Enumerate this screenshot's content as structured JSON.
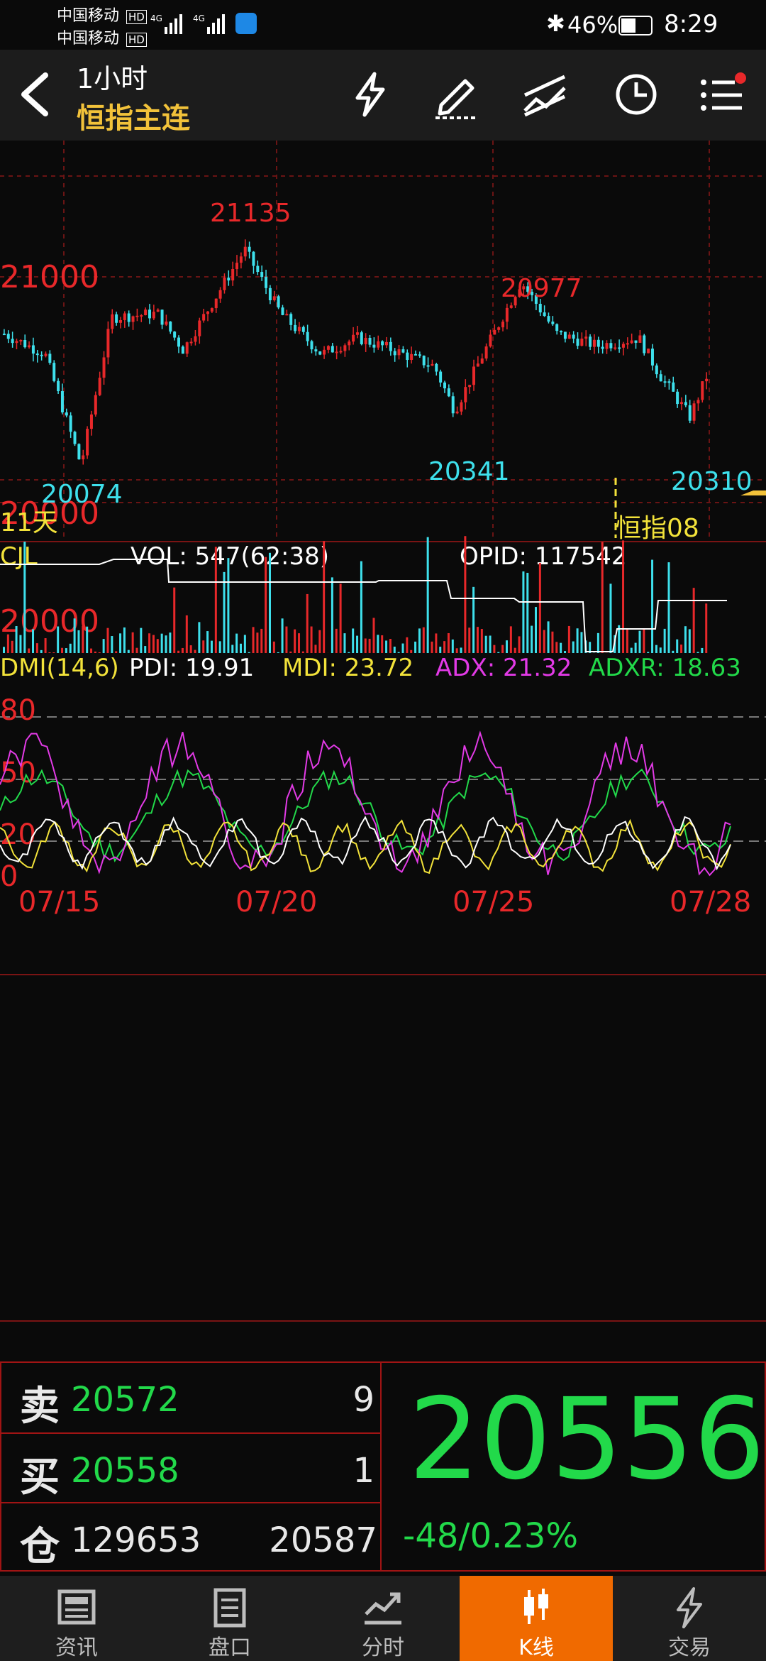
{
  "status_bar": {
    "carrier1": "中国移动",
    "carrier2": "中国移动",
    "hd": "HD",
    "network": "4G",
    "battery": "46%",
    "time": "8:29"
  },
  "header": {
    "period": "1小时",
    "instrument": "恒指主连"
  },
  "main_chart": {
    "y_labels": [
      "21000",
      "20000"
    ],
    "high_label": "21135",
    "low_label": "20074",
    "mark_20977": "20977",
    "mark_20341": "20341",
    "mark_20310": "20310",
    "days_label": "11天",
    "contract_label": "恒指08"
  },
  "volume_panel": {
    "name": "CJL",
    "vol": "VOL: 547(62:38)",
    "opid": "OPID: 117542",
    "axis_label": "20000"
  },
  "dmi_panel": {
    "name": "DMI(14,6)",
    "pdi": "PDI: 19.91",
    "mdi": "MDI: 23.72",
    "adx": "ADX: 21.32",
    "adxr": "ADXR: 18.63",
    "y_labels": [
      "80",
      "50",
      "20",
      "0"
    ]
  },
  "x_axis": [
    "07/15",
    "07/20",
    "07/25",
    "07/28"
  ],
  "quote": {
    "sell_label": "卖",
    "sell_price": "20572",
    "sell_qty": "9",
    "buy_label": "买",
    "buy_price": "20558",
    "buy_qty": "1",
    "position_label": "仓",
    "position": "129653",
    "settle": "20587",
    "last_price": "20556",
    "change": "-48/0.23%"
  },
  "tabs": [
    {
      "label": "资讯",
      "icon": "news-icon"
    },
    {
      "label": "盘口",
      "icon": "orderbook-icon"
    },
    {
      "label": "分时",
      "icon": "timeshare-icon"
    },
    {
      "label": "K线",
      "icon": "candlestick-icon",
      "active": true
    },
    {
      "label": "交易",
      "icon": "trade-icon"
    }
  ],
  "colors": {
    "up": "#e8282a",
    "down": "#3ee0ec",
    "accent": "#f06a00",
    "price_green": "#22d94a",
    "title_yellow": "#f2c23a"
  }
}
